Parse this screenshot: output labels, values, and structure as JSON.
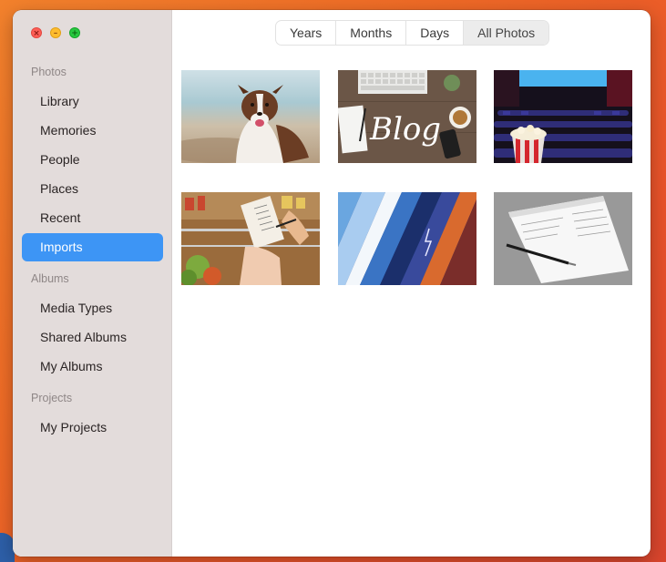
{
  "window": {
    "controls": {
      "close": "close-button",
      "minimize": "minimize-button",
      "zoom": "zoom-button"
    }
  },
  "sidebar": {
    "sections": [
      {
        "heading": "Photos",
        "items": [
          "Library",
          "Memories",
          "People",
          "Places",
          "Recent",
          "Imports"
        ]
      },
      {
        "heading": "Albums",
        "items": [
          "Media Types",
          "Shared Albums",
          "My Albums"
        ]
      },
      {
        "heading": "Projects",
        "items": [
          "My Projects"
        ]
      }
    ],
    "selected": "Imports"
  },
  "toolbar": {
    "segments": [
      "Years",
      "Months",
      "Days",
      "All Photos"
    ],
    "active": "All Photos"
  },
  "photos": [
    {
      "subject": "dog-on-beach"
    },
    {
      "subject": "blog-desk-flatlay",
      "overlay_text": "Blog"
    },
    {
      "subject": "cinema-popcorn"
    },
    {
      "subject": "grocery-shopping-list"
    },
    {
      "subject": "weather-strips"
    },
    {
      "subject": "notepad-and-pen"
    }
  ],
  "colors": {
    "accent": "#3d95f5",
    "sidebar_bg": "#e3dcdb",
    "desktop": "#ee6a26"
  }
}
